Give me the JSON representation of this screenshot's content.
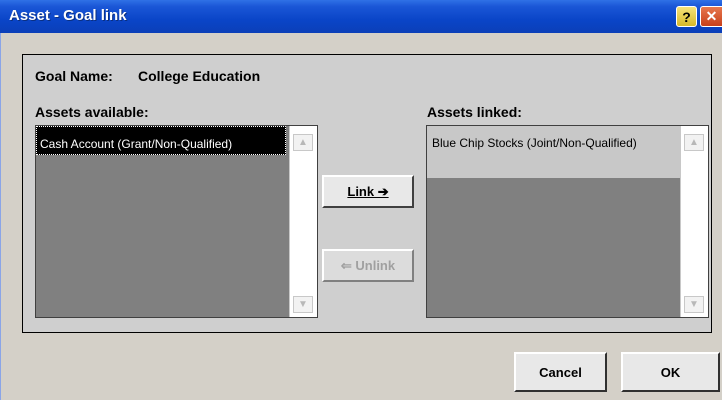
{
  "window": {
    "title": "Asset - Goal link",
    "help_glyph": "?",
    "close_glyph": "✕"
  },
  "goal": {
    "label": "Goal Name:",
    "value": "College Education"
  },
  "available": {
    "header": "Assets available:",
    "items": [
      "Cash Account (Grant/Non-Qualified)"
    ]
  },
  "linked": {
    "header": "Assets linked:",
    "items": [
      "Blue Chip Stocks (Joint/Non-Qualified)"
    ]
  },
  "buttons": {
    "link": "Link ➔",
    "unlink": "⇐ Unlink",
    "cancel": "Cancel",
    "ok": "OK"
  },
  "scroll": {
    "up_glyph": "▲",
    "down_glyph": "▼"
  },
  "icons": {
    "help": "help-icon",
    "close": "close-icon",
    "scroll_up": "chevron-up-icon",
    "scroll_down": "chevron-down-icon"
  }
}
